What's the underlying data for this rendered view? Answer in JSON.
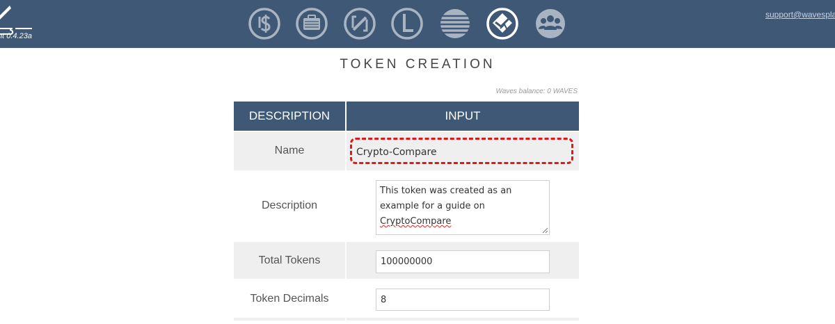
{
  "header": {
    "version": "nt 0.4.23a",
    "support_email": "support@wavesplat",
    "nav_icons": [
      {
        "name": "dollar-icon"
      },
      {
        "name": "wallet-icon"
      },
      {
        "name": "lease-icon"
      },
      {
        "name": "dex-icon"
      },
      {
        "name": "history-icon"
      },
      {
        "name": "token-creation-icon",
        "active": true
      },
      {
        "name": "community-icon"
      }
    ]
  },
  "page": {
    "title": "TOKEN CREATION",
    "balance": "Waves balance: 0 WAVES"
  },
  "table": {
    "col_description": "DESCRIPTION",
    "col_input": "INPUT",
    "rows": [
      {
        "label": "Name",
        "value": "Crypto-Compare"
      },
      {
        "label": "Description",
        "value_line1": "This token was created as an",
        "value_line2": "example for a guide on",
        "value_line3": "CryptoCompare"
      },
      {
        "label": "Total Tokens",
        "value": "100000000"
      },
      {
        "label": "Token Decimals",
        "value": "8"
      }
    ]
  },
  "colors": {
    "header_bg": "#3e5876",
    "row_alt": "#efefef",
    "highlight": "#e01818"
  }
}
